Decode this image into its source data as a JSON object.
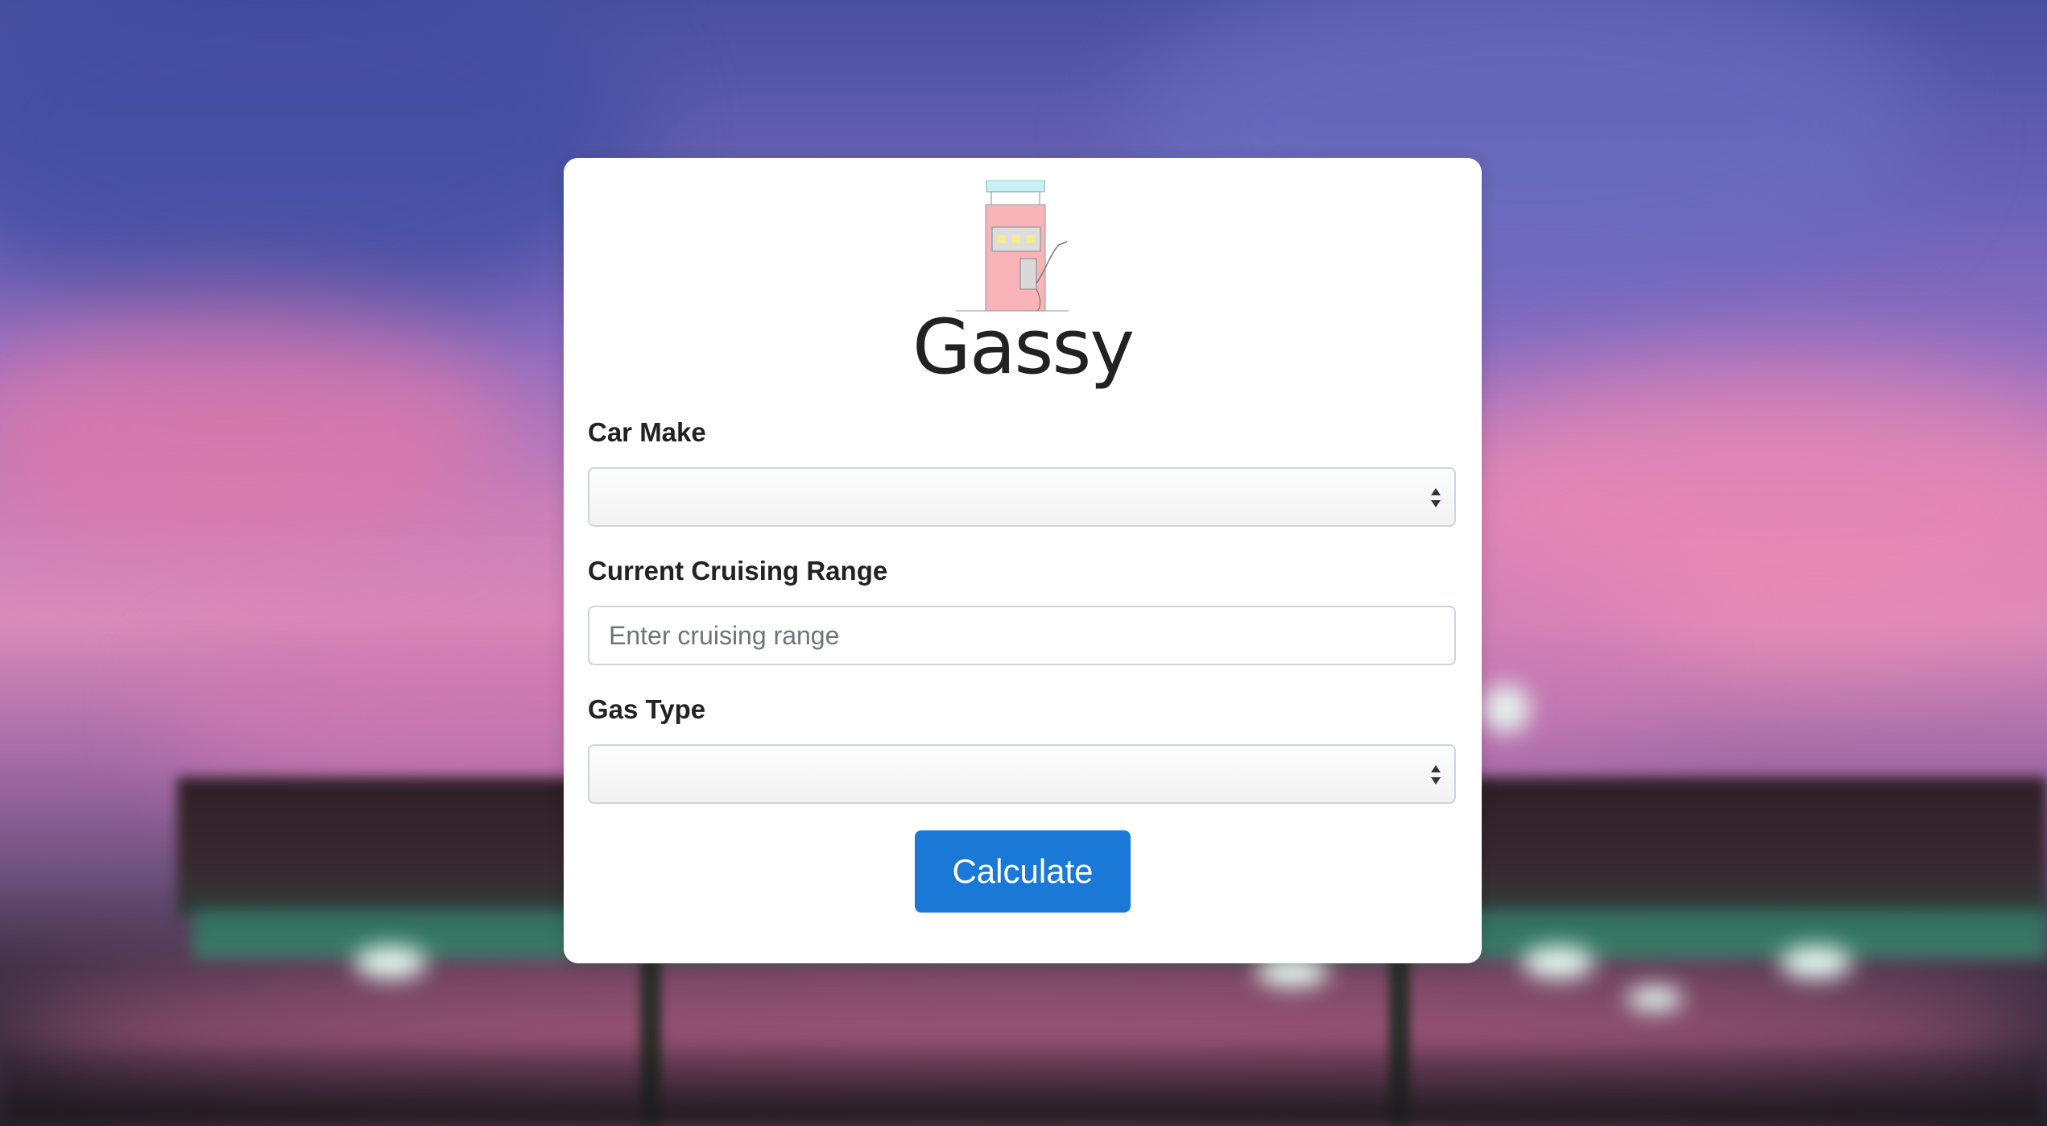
{
  "app": {
    "title": "Gassy",
    "colors": {
      "card": "#ffffff",
      "primary_button": "#1a78d6",
      "pump_body": "#f8b4b8",
      "pump_top": "#c9f0f5",
      "pump_lights": "#f5eb8c"
    }
  },
  "form": {
    "car_make": {
      "label": "Car Make",
      "value": ""
    },
    "cruising_range": {
      "label": "Current Cruising Range",
      "placeholder": "Enter cruising range",
      "value": ""
    },
    "gas_type": {
      "label": "Gas Type",
      "value": ""
    },
    "submit_label": "Calculate"
  },
  "icons": {
    "logo": "gas-pump-icon",
    "select_arrows": "sort-arrows-icon"
  }
}
